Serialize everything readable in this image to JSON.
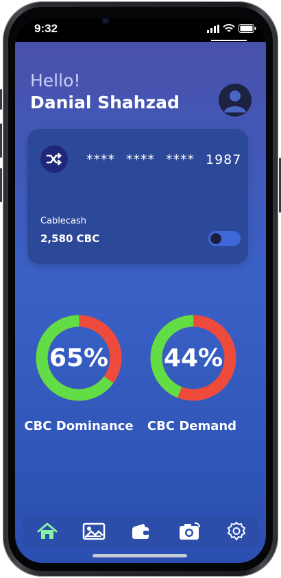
{
  "status_bar": {
    "time": "9:32"
  },
  "header": {
    "greeting": "Hello!",
    "user_name": "Danial Shahzad",
    "avatar_icon": "user-avatar-icon"
  },
  "card": {
    "logo_icon": "shuffle-icon",
    "number_groups": [
      "****",
      "****",
      "****",
      "1987"
    ],
    "name": "Cablecash",
    "balance": "2,580 CBC",
    "toggle_on": false
  },
  "gauges": [
    {
      "value_label": "65%",
      "value": 65,
      "label": "CBC Dominance",
      "color_primary": "#63dd45",
      "color_secondary": "#ee4b3d"
    },
    {
      "value_label": "44%",
      "value": 44,
      "label": "CBC Demand",
      "color_primary": "#63dd45",
      "color_secondary": "#ee4b3d"
    }
  ],
  "nav": {
    "items": [
      {
        "icon": "home-icon",
        "active": true
      },
      {
        "icon": "image-icon",
        "active": false
      },
      {
        "icon": "wallet-icon",
        "active": false
      },
      {
        "icon": "camera-icon",
        "active": false
      },
      {
        "icon": "gear-icon",
        "active": false
      }
    ]
  },
  "colors": {
    "accent_green": "#63dd45",
    "accent_red": "#ee4b3d",
    "active_nav": "#8af0a8"
  }
}
